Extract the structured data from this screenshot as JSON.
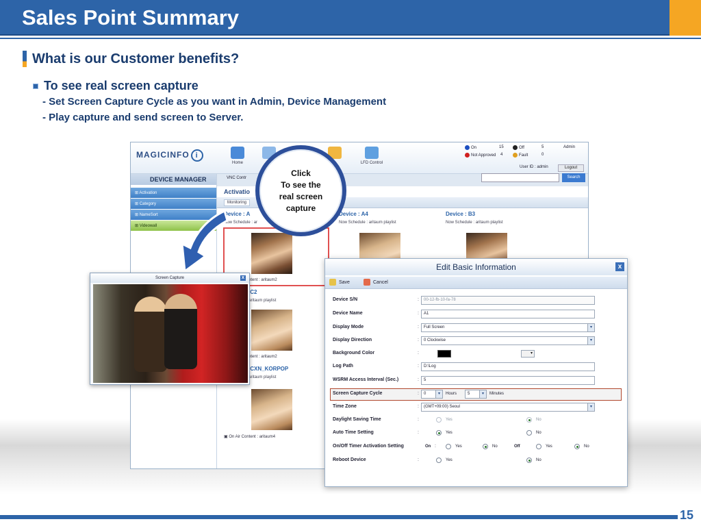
{
  "slide": {
    "title": "Sales Point Summary",
    "heading": "What is our Customer benefits?",
    "bullet": "To see real screen capture",
    "subbullets": [
      "-  Set Screen Capture Cycle as you want in Admin, Device Management",
      "-  Play capture and send screen to Server."
    ],
    "page_number": "15",
    "accent_color": "#2d64a8",
    "orange_color": "#f5a623"
  },
  "callout": {
    "line1": "Click",
    "line2": "To see the",
    "line3": "real screen",
    "line4": "capture"
  },
  "app": {
    "logo": "MAGICINFO",
    "logo_icon": "i",
    "toolbar": [
      {
        "label": "Home",
        "icon": "home-icon"
      },
      {
        "label": "",
        "icon": "schedule-icon"
      },
      {
        "label": "",
        "icon": "device-icon"
      },
      {
        "label": "LFD Control",
        "icon": "lfd-control-icon"
      }
    ],
    "status": {
      "on_label": "On",
      "on_count": "15",
      "off_label": "Off",
      "off_count": "5",
      "admin_label": "Admin",
      "not_approved_label": "Not Approved",
      "not_approved_count": "4",
      "fault_label": "Fault",
      "fault_count": "0"
    },
    "user_id": "User ID : admin",
    "logout": "Logout",
    "search": "Search",
    "sidebar_title": "DEVICE MANAGER",
    "vnc_label": "VNC Contr",
    "sidebar_items": [
      {
        "label": "Activation"
      },
      {
        "label": "Category"
      },
      {
        "label": "NameSort"
      },
      {
        "label": "Videowall"
      }
    ],
    "content_tab": "Activatio",
    "monitoring_tab": "Monitoring",
    "devices": [
      {
        "title": "Device : A",
        "schedule": "Now Schedule : ar",
        "onair": "On Air Content : aritaum2"
      },
      {
        "title": "Device : A4",
        "schedule": "Now Schedule : aritaum playlist"
      },
      {
        "title": "Device : B3",
        "schedule": "Now Schedule : aritaum playlist"
      },
      {
        "title": "ice : C2",
        "schedule": "dule : aritaum playlist",
        "onair": "On Air Content : aritaum2"
      },
      {
        "title": "ice : CXN_KORPOP",
        "schedule": "dule : aritaum playlist",
        "onair": "On Air Content : aritaum4"
      }
    ]
  },
  "capture_window": {
    "title": "Screen Capture",
    "close": "x"
  },
  "dialog": {
    "title": "Edit Basic Information",
    "close": "x",
    "save": "Save",
    "cancel": "Cancel",
    "fields": {
      "device_sn_label": "Device S/N",
      "device_sn_value": "00-12-fb-10-fa-78",
      "device_name_label": "Device Name",
      "device_name_value": "A1",
      "display_mode_label": "Display Mode",
      "display_mode_value": "Full Screen",
      "display_direction_label": "Display Direction",
      "display_direction_value": "0 Clockwise",
      "bg_color_label": "Background Color",
      "log_path_label": "Log Path",
      "log_path_value": "D:\\Log",
      "wsrm_label": "WSRM Access Interval (Sec.)",
      "wsrm_value": "5",
      "capture_label": "Screen Capture Cycle",
      "capture_hours": "0",
      "hours_unit": "Hours",
      "capture_minutes": "5",
      "minutes_unit": "Minutes",
      "timezone_label": "Time Zone",
      "timezone_value": "(GMT+09:00) Seoul",
      "dst_label": "Daylight Saving Time",
      "dst_yes": "Yes",
      "dst_no": "No",
      "auto_time_label": "Auto Time Setting",
      "auto_yes": "Yes",
      "auto_no": "No",
      "timer_label": "On/Off Timer Activation Setting",
      "timer_on": "On",
      "timer_off": "Off",
      "timer_yes": "Yes",
      "timer_no": "No",
      "reboot_label": "Reboot Device",
      "reboot_yes": "Yes",
      "reboot_no": "No"
    }
  }
}
